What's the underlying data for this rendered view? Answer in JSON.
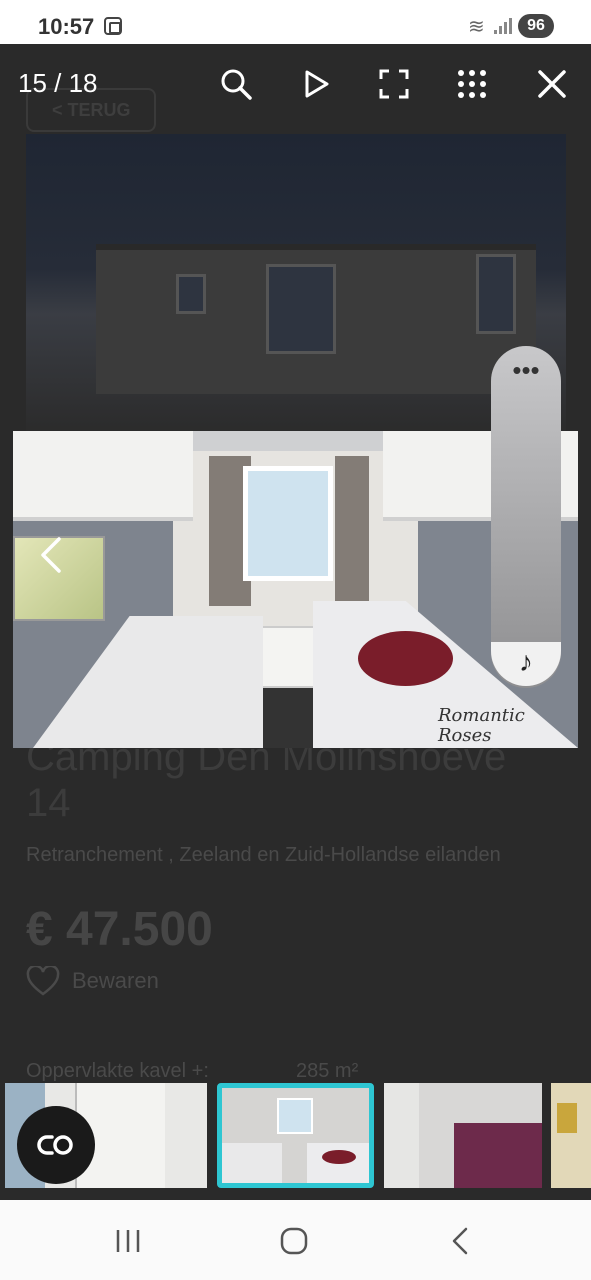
{
  "status_bar": {
    "time": "10:57",
    "battery": "96"
  },
  "viewer": {
    "counter": "15 / 18",
    "toolbar_icons": [
      "search-icon",
      "play-icon",
      "fullscreen-icon",
      "grid-icon",
      "close-icon"
    ]
  },
  "background_page": {
    "back_label": "< TERUG",
    "title_line1": "Camping Den Molinshoeve",
    "title_line2": "14",
    "location": "Retranchement , Zeeland en Zuid-Hollandse eilanden",
    "price": "€ 47.500",
    "save_label": "Bewaren",
    "spec_label": "Oppervlakte kavel +:",
    "spec_value": "285 m²"
  },
  "photo": {
    "caption_text": "Romantic Roses"
  },
  "media_pill": {
    "menu": "•••",
    "music_icon": "♪"
  },
  "thumbnails": {
    "count": 5,
    "active_index": 1
  },
  "colors": {
    "accent": "#2ec6d2",
    "overlay": "#1c1c1c"
  }
}
